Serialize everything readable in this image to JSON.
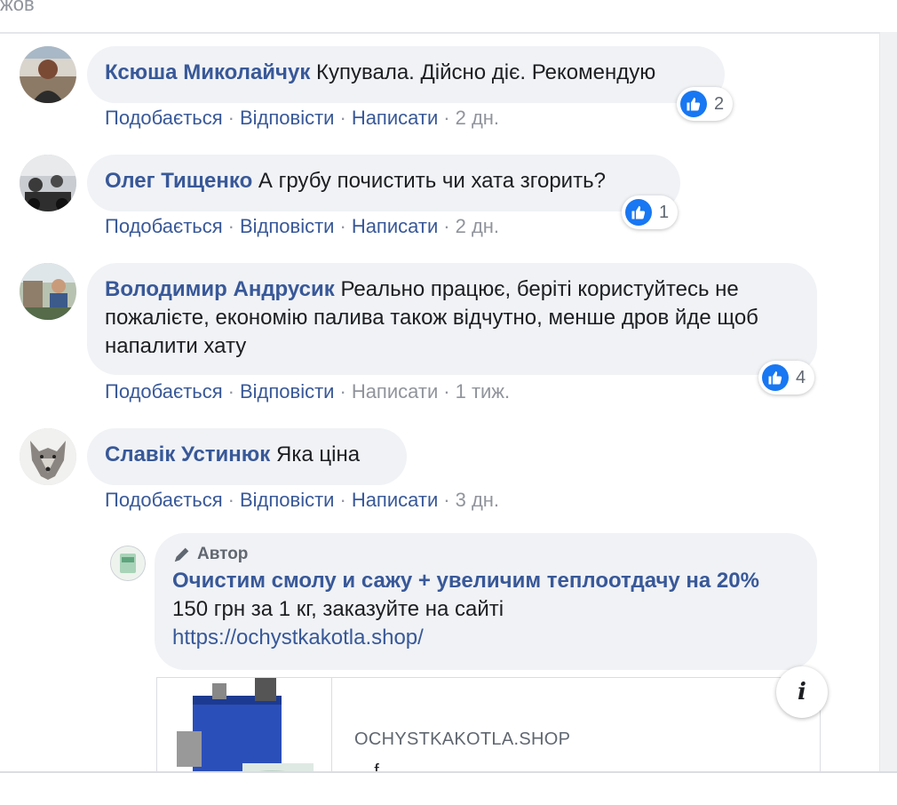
{
  "top_partial_text": "жов",
  "comments": [
    {
      "author": "Ксюша Миколайчук",
      "text": "Купувала. Дійсно діє. Рекомендую",
      "like_label": "Подобається",
      "reply_label": "Відповісти",
      "message_label": "Написати",
      "time": "2 дн.",
      "reaction_count": "2"
    },
    {
      "author": "Олег Тищенко",
      "text": "А грубу почистить чи хата згорить?",
      "like_label": "Подобається",
      "reply_label": "Відповісти",
      "message_label": "Написати",
      "time": "2 дн.",
      "reaction_count": "1"
    },
    {
      "author": "Володимир Андрусик",
      "text": "Реально працює, беріті користуйтесь не пожалієте, економію палива також відчутно, менше дров йде щоб напалити хату",
      "like_label": "Подобається",
      "reply_label": "Відповісти",
      "message_label": "Написати",
      "time": "1 тиж.",
      "reaction_count": "4"
    },
    {
      "author": "Славік Устинюк",
      "text": "Яка ціна",
      "like_label": "Подобається",
      "reply_label": "Відповісти",
      "message_label": "Написати",
      "time": "3 дн."
    }
  ],
  "reply": {
    "author_tag": "Автор",
    "headline": "Очистим смолу и сажу + увеличим теплоотдачу на 20%",
    "text": " 150 грн за 1 кг, заказуйте на сайті",
    "url": "https://ochystkakotla.shop/",
    "card_domain": "OCHYSTKAKOTLA.SHOP",
    "card_sub": "... f ..."
  },
  "colors": {
    "link": "#385898",
    "bubble": "#f0f2f5",
    "like_blue": "#1877f2",
    "meta_gray": "#90949c"
  }
}
